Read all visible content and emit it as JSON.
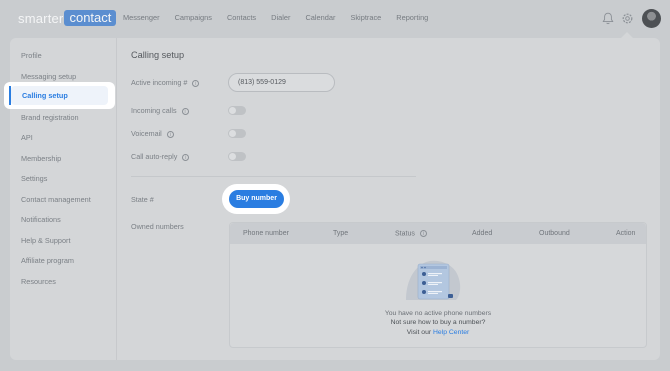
{
  "logo": {
    "part1": "smarter",
    "part2": "contact"
  },
  "nav": [
    "Messenger",
    "Campaigns",
    "Contacts",
    "Dialer",
    "Calendar",
    "Skiptrace",
    "Reporting"
  ],
  "icons": {
    "bell": "bell-icon",
    "gear": "gear-icon",
    "info": "info-icon"
  },
  "sidebar": {
    "items": [
      "Profile",
      "Messaging setup",
      "Calling setup",
      "Brand registration",
      "API",
      "Membership",
      "Settings",
      "Contact management",
      "Notifications",
      "Help & Support",
      "Affiliate program",
      "Resources"
    ],
    "active": "Calling setup"
  },
  "page": {
    "title": "Calling setup",
    "active_incoming_label": "Active incoming #",
    "active_incoming_value": "(813) 559-0129",
    "incoming_calls_label": "Incoming calls",
    "voicemail_label": "Voicemail",
    "auto_reply_label": "Call auto-reply",
    "state_label": "State #",
    "buy_button": "Buy number",
    "owned_numbers_label": "Owned numbers"
  },
  "table": {
    "columns": [
      "Phone number",
      "Type",
      "Status",
      "Added",
      "Outbound",
      "Action"
    ],
    "empty_line1": "You have no active phone numbers",
    "empty_line2": "Not sure how to buy a number?",
    "empty_line3_prefix": "Visit our",
    "help_link": "Help Center"
  },
  "colors": {
    "accent": "#2a7de1",
    "background": "#c9cccf",
    "card": "#d4d6d8"
  }
}
